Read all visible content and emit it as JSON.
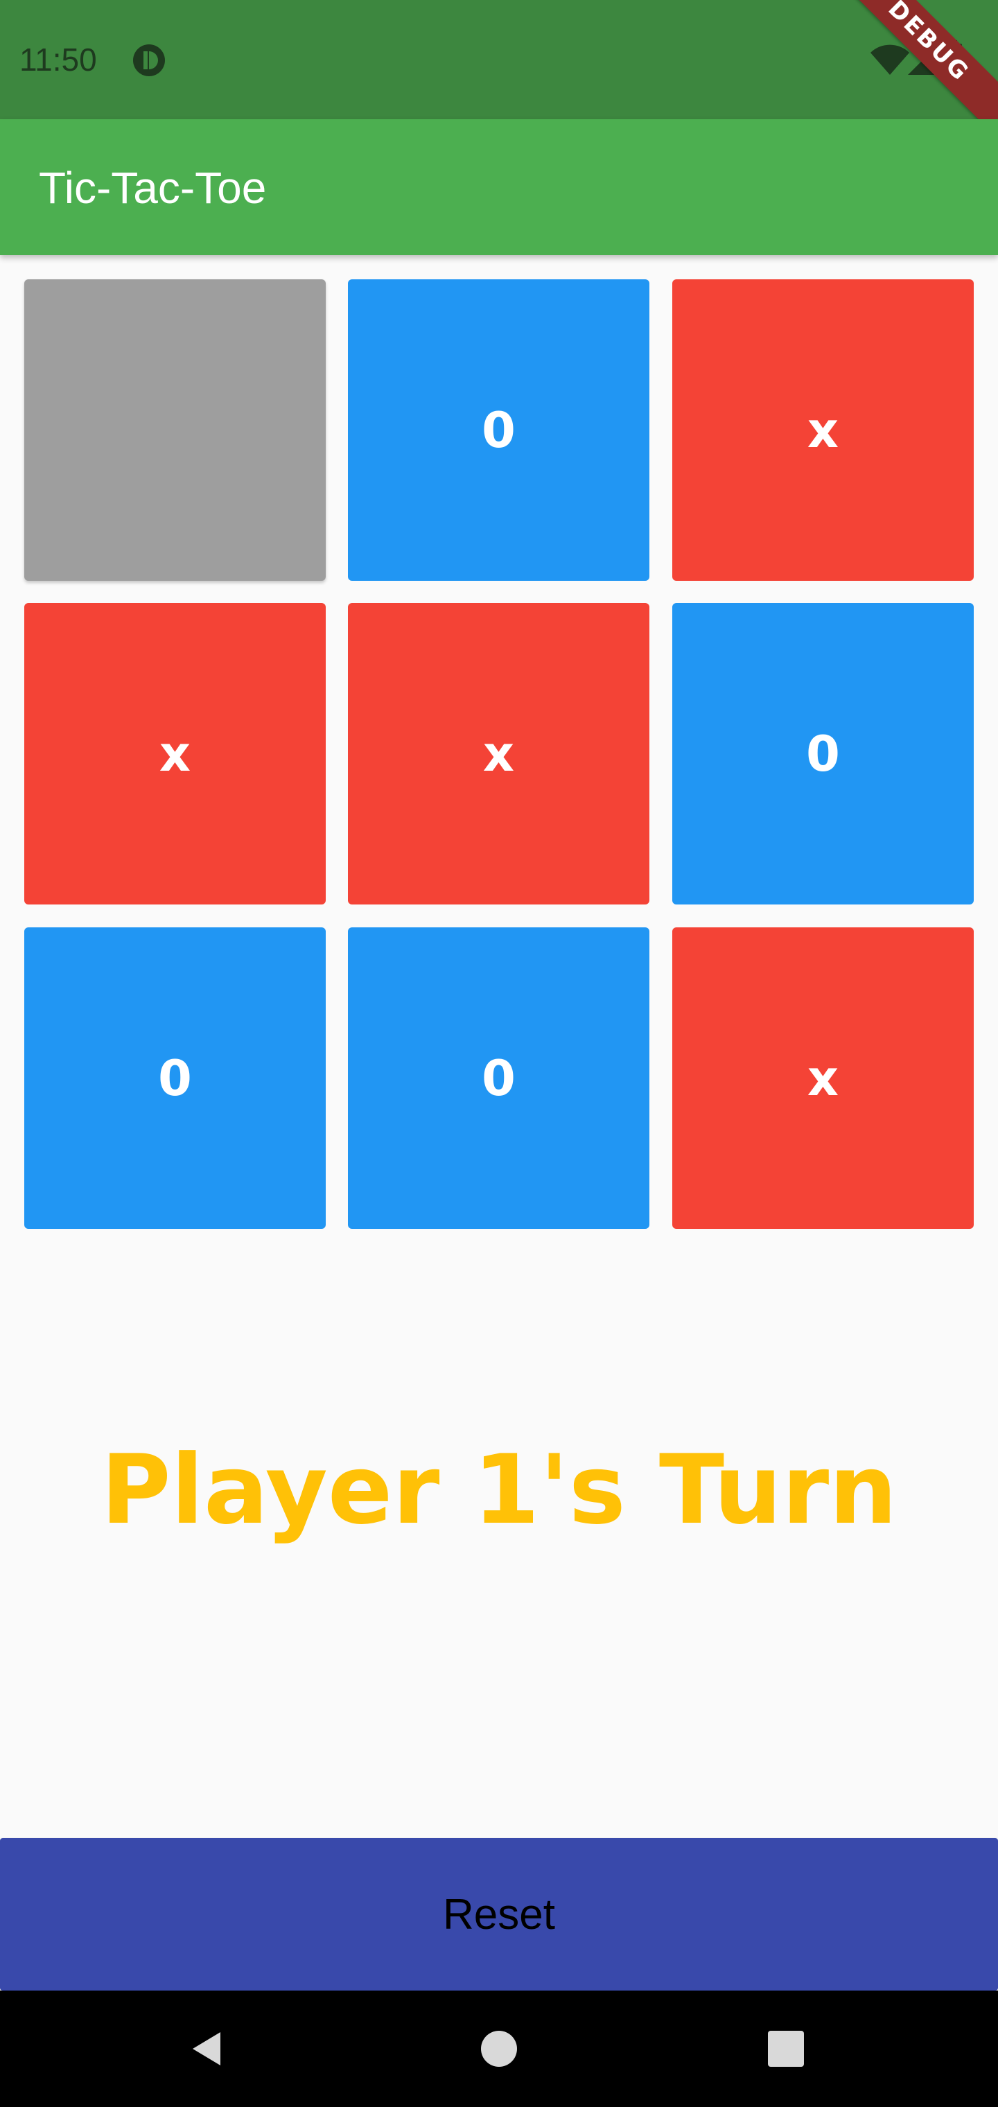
{
  "status_bar": {
    "time": "11:50",
    "debug_label": "DEBUG"
  },
  "app_bar": {
    "title": "Tic-Tac-Toe"
  },
  "board": {
    "cells": [
      {
        "value": "",
        "state": "empty"
      },
      {
        "value": "0",
        "state": "o"
      },
      {
        "value": "x",
        "state": "x"
      },
      {
        "value": "x",
        "state": "x"
      },
      {
        "value": "x",
        "state": "x"
      },
      {
        "value": "0",
        "state": "o"
      },
      {
        "value": "0",
        "state": "o"
      },
      {
        "value": "0",
        "state": "o"
      },
      {
        "value": "x",
        "state": "x"
      }
    ]
  },
  "status": {
    "turn_text": "Player 1's Turn"
  },
  "actions": {
    "reset_label": "Reset"
  },
  "colors": {
    "status_bar": "#3D873F",
    "app_bar": "#4CAF50",
    "empty_cell": "#9E9E9E",
    "o_cell": "#2196F3",
    "x_cell": "#F44336",
    "turn_text": "#FFC107",
    "reset_button": "#3949AB"
  },
  "icons": {
    "status_app": "app-status-icon",
    "wifi": "wifi-icon",
    "signal": "signal-icon",
    "battery": "battery-icon",
    "nav_back": "back-icon",
    "nav_home": "home-icon",
    "nav_recents": "recents-icon"
  }
}
